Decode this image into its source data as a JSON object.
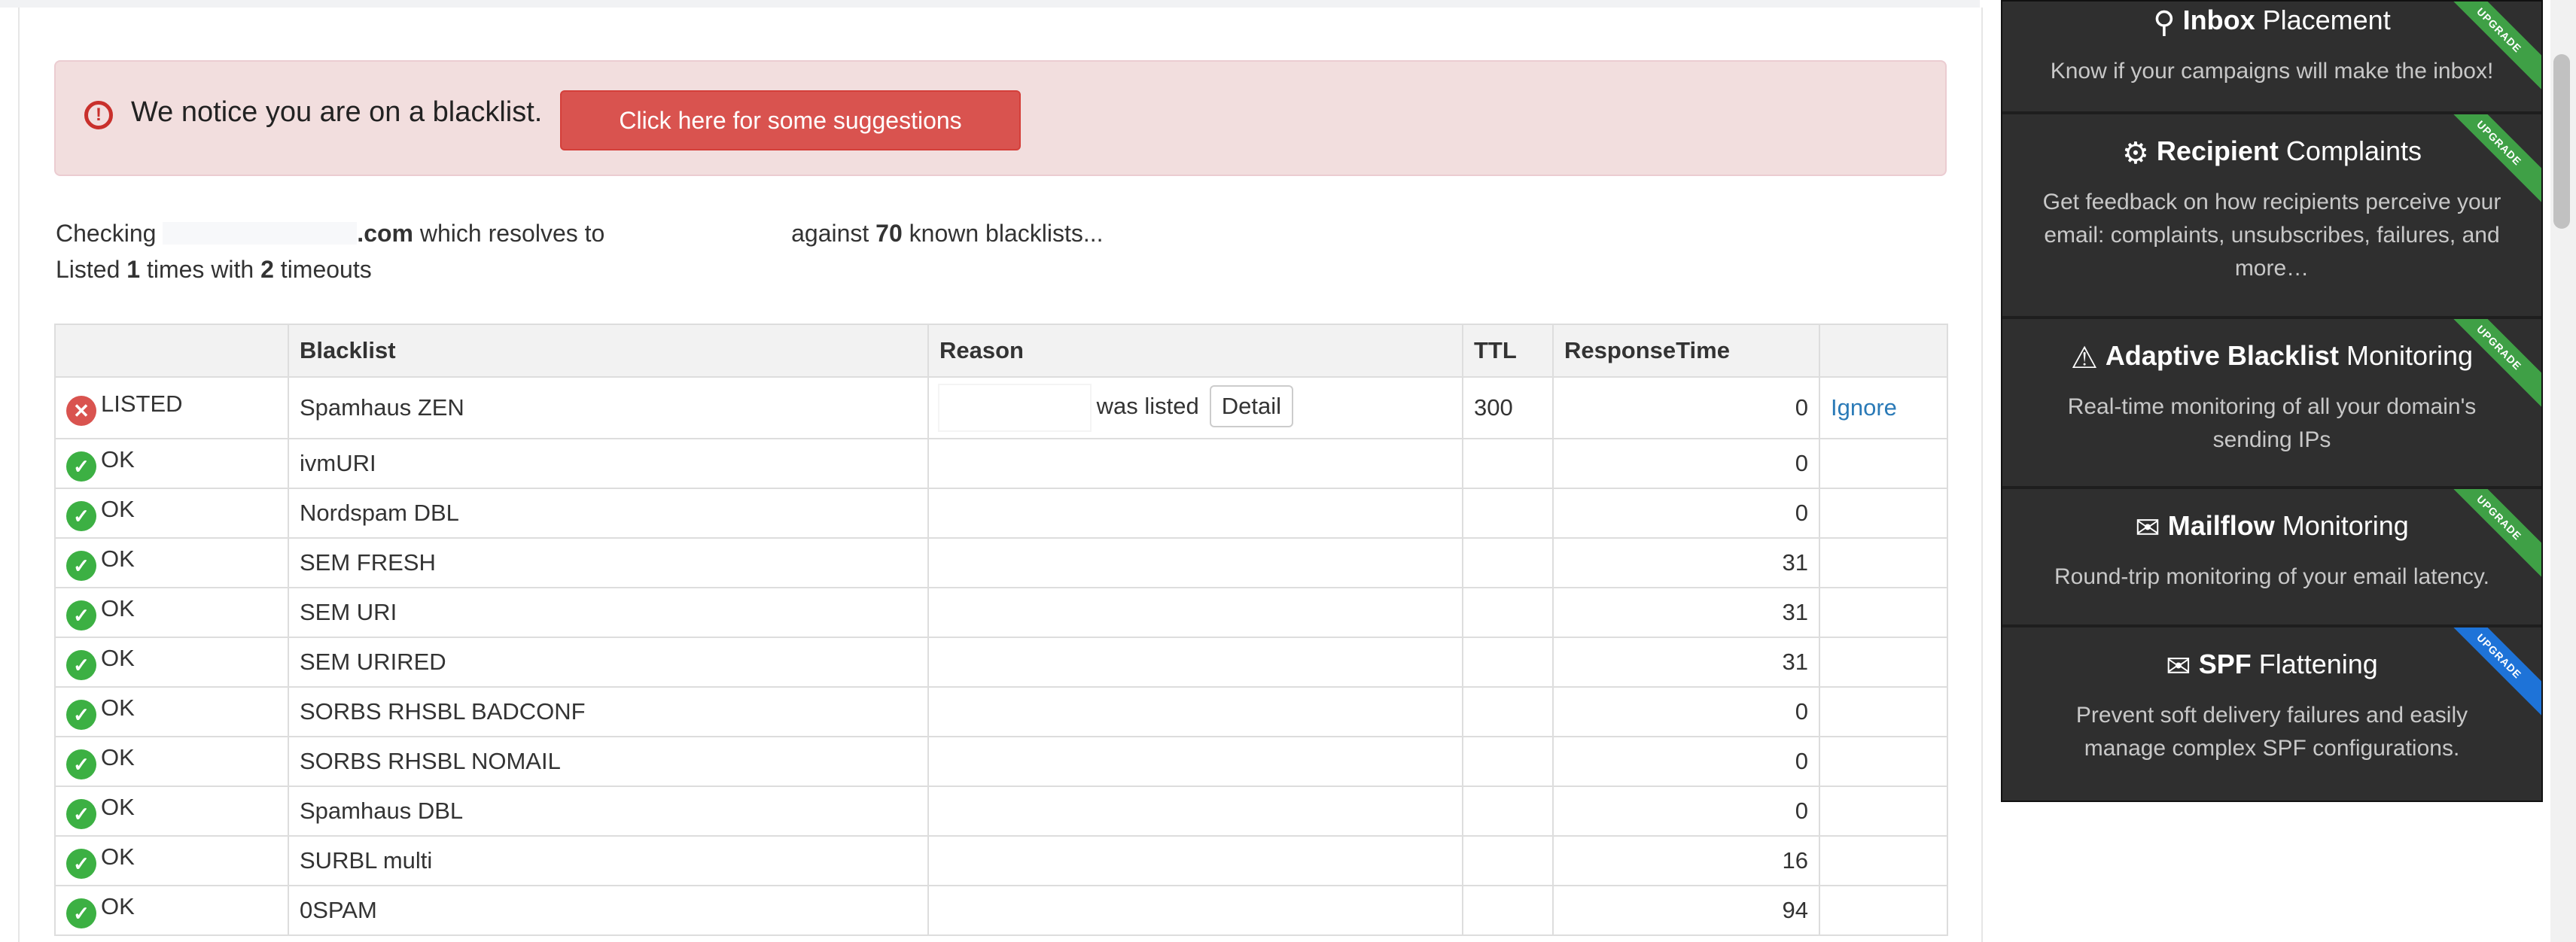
{
  "alert": {
    "message": "We notice you are on a blacklist.",
    "button_label": "Click here for some suggestions"
  },
  "summary": {
    "checking_prefix": "Checking",
    "domain_suffix": ".com",
    "resolves_text": "which resolves to",
    "against_text": "against",
    "blacklist_count": "70",
    "known_text": "known blacklists...",
    "listed_prefix": "Listed",
    "listed_count": "1",
    "times_with": "times with",
    "timeout_count": "2",
    "timeouts_text": "timeouts"
  },
  "table": {
    "headers": [
      "",
      "Blacklist",
      "Reason",
      "TTL",
      "ResponseTime",
      ""
    ],
    "rows": [
      {
        "status": "LISTED",
        "blacklist": "Spamhaus ZEN",
        "reason": "was listed",
        "detail": "Detail",
        "ttl": "300",
        "response": "0",
        "action": "Ignore"
      },
      {
        "status": "OK",
        "blacklist": "ivmURI",
        "reason": "",
        "ttl": "",
        "response": "0",
        "action": ""
      },
      {
        "status": "OK",
        "blacklist": "Nordspam DBL",
        "reason": "",
        "ttl": "",
        "response": "0",
        "action": ""
      },
      {
        "status": "OK",
        "blacklist": "SEM FRESH",
        "reason": "",
        "ttl": "",
        "response": "31",
        "action": ""
      },
      {
        "status": "OK",
        "blacklist": "SEM URI",
        "reason": "",
        "ttl": "",
        "response": "31",
        "action": ""
      },
      {
        "status": "OK",
        "blacklist": "SEM URIRED",
        "reason": "",
        "ttl": "",
        "response": "31",
        "action": ""
      },
      {
        "status": "OK",
        "blacklist": "SORBS RHSBL BADCONF",
        "reason": "",
        "ttl": "",
        "response": "0",
        "action": ""
      },
      {
        "status": "OK",
        "blacklist": "SORBS RHSBL NOMAIL",
        "reason": "",
        "ttl": "",
        "response": "0",
        "action": ""
      },
      {
        "status": "OK",
        "blacklist": "Spamhaus DBL",
        "reason": "",
        "ttl": "",
        "response": "0",
        "action": ""
      },
      {
        "status": "OK",
        "blacklist": "SURBL multi",
        "reason": "",
        "ttl": "",
        "response": "16",
        "action": ""
      },
      {
        "status": "OK",
        "blacklist": "0SPAM",
        "reason": "",
        "ttl": "",
        "response": "94",
        "action": ""
      }
    ]
  },
  "sidebar": {
    "cards": [
      {
        "title_bold": "Inbox",
        "title_rest": "Placement",
        "desc": "Know if your campaigns will make the inbox!",
        "ribbon": "UPGRADE",
        "ribbon_color": "#3fa046",
        "icon": "magnifier-icon"
      },
      {
        "title_bold": "Recipient",
        "title_rest": "Complaints",
        "desc": "Get feedback on how recipients perceive your email: complaints, unsubscribes, failures, and more…",
        "ribbon": "UPGRADE",
        "ribbon_color": "#3fa046",
        "icon": "gears-icon"
      },
      {
        "title_bold": "Adaptive Blacklist",
        "title_rest": "Monitoring",
        "desc": "Real-time monitoring of all your domain's sending IPs",
        "ribbon": "UPGRADE",
        "ribbon_color": "#3fa046",
        "icon": "warning-icon"
      },
      {
        "title_bold": "Mailflow",
        "title_rest": "Monitoring",
        "desc": "Round-trip monitoring of your email latency.",
        "ribbon": "UPGRADE",
        "ribbon_color": "#3fa046",
        "icon": "mailbox-icon"
      },
      {
        "title_bold": "SPF",
        "title_rest": "Flattening",
        "desc": "Prevent soft delivery failures and easily manage complex SPF configurations.",
        "ribbon": "UPGRADE",
        "ribbon_color": "#1e73d8",
        "icon": "mailbox-icon"
      }
    ]
  },
  "colors": {
    "alert_bg": "#f2dede",
    "danger": "#d9534f",
    "ok_green": "#3cb043",
    "link_blue": "#2a7ab7",
    "sidebar_bg": "#2f2f2f"
  }
}
